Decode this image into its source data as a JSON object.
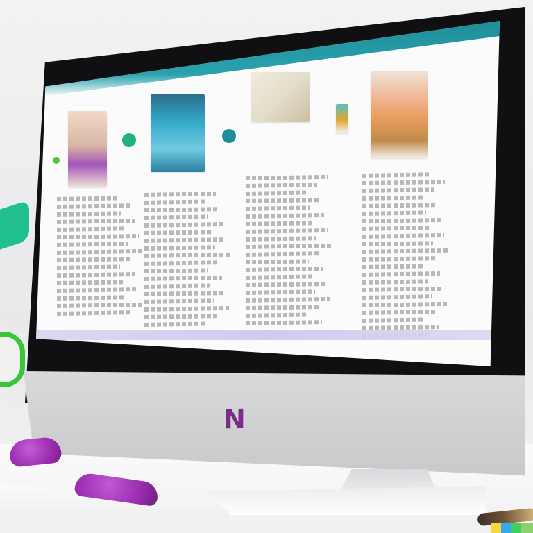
{
  "scene": {
    "monitor_logo": "N"
  },
  "screen": {
    "columns": [
      {
        "title": "",
        "lines": 16
      },
      {
        "title": "",
        "lines": 18
      },
      {
        "title": "",
        "lines": 20
      },
      {
        "title": "",
        "lines": 22
      }
    ]
  },
  "colors": {
    "accent_teal": "#29a2ae",
    "accent_purple": "#9d2cb1",
    "accent_green": "#39c43a"
  },
  "icons": {
    "screen_icons": [
      "green-circle-icon",
      "teal-circle-icon",
      "small-green-dot-icon"
    ]
  }
}
